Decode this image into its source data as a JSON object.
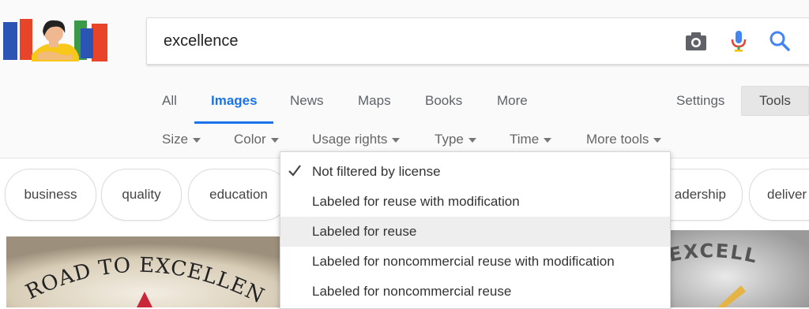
{
  "search": {
    "query": "excellence"
  },
  "icons": {
    "camera": "camera-icon",
    "mic": "microphone-icon",
    "search": "search-icon",
    "check": "check-icon",
    "caret": "caret-down-icon"
  },
  "tabs": [
    {
      "label": "All"
    },
    {
      "label": "Images"
    },
    {
      "label": "News"
    },
    {
      "label": "Maps"
    },
    {
      "label": "Books"
    },
    {
      "label": "More"
    }
  ],
  "settings_label": "Settings",
  "tools_label": "Tools",
  "tools_row": [
    {
      "label": "Size"
    },
    {
      "label": "Color"
    },
    {
      "label": "Usage rights"
    },
    {
      "label": "Type"
    },
    {
      "label": "Time"
    },
    {
      "label": "More tools"
    }
  ],
  "chips": [
    "business",
    "quality",
    "education",
    "adership",
    "deliver"
  ],
  "dropdown": {
    "items": [
      {
        "label": "Not filtered by license",
        "checked": true
      },
      {
        "label": "Labeled for reuse with modification"
      },
      {
        "label": "Labeled for reuse",
        "highlighted": true
      },
      {
        "label": "Labeled for noncommercial reuse with modification"
      },
      {
        "label": "Labeled for noncommercial reuse"
      }
    ]
  },
  "thumbnails": {
    "left_text": "ROAD TO EXCELLEN",
    "right_text": "EXCELL"
  },
  "colors": {
    "accent": "#1a73e8",
    "mic_red": "#ea4335",
    "mic_blue": "#4285f4"
  }
}
